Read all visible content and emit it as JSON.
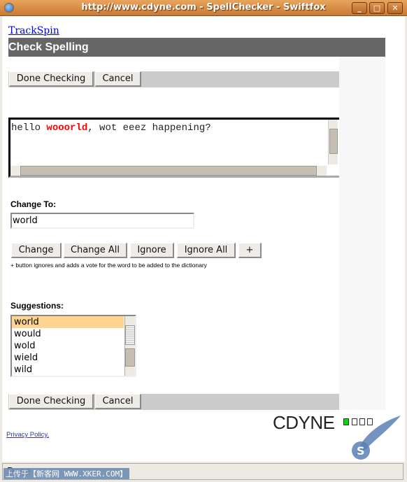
{
  "window": {
    "title": "http://www.cdyne.com - SpellChecker - Swiftfox",
    "minimize": "_",
    "maximize": "□",
    "close": "✕"
  },
  "page": {
    "link": "TrackSpin",
    "header": "Check Spelling",
    "top_buttons": {
      "done": "Done Checking",
      "cancel": "Cancel"
    },
    "editor": {
      "before": "hello ",
      "misspelled": "wooorld",
      "after": ", wot eeez happening?"
    },
    "change_to_label": "Change To:",
    "change_to_value": "world",
    "actions": [
      "Change",
      "Change All",
      "Ignore",
      "Ignore All",
      "+"
    ],
    "note": "+ button ignores and adds a vote for the word to be added to the dictionary",
    "suggestions_label": "Suggestions:",
    "suggestions": [
      "world",
      "would",
      "wold",
      "wield",
      "wild"
    ],
    "selected_suggestion": "world",
    "bottom_buttons": {
      "done": "Done Checking",
      "cancel": "Cancel"
    },
    "privacy": "Privacy Policy.",
    "logo": "CDYNE"
  },
  "status": "Done",
  "watermark": "上传于【新客网 WWW.XKER.COM】",
  "colors": {
    "titlebar": "#d08a45",
    "header": "#666666",
    "misspelled": "#ff0000",
    "selection": "#fed490",
    "logo_square": "#00dd00"
  }
}
